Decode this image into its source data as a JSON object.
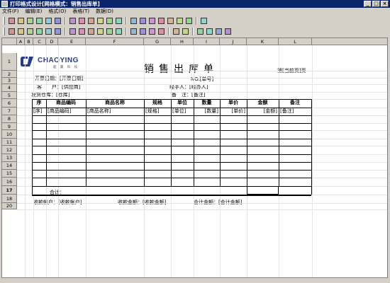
{
  "window": {
    "title": "打印格式设计[网格模式：销售出库单]"
  },
  "menu": [
    "文件(F)",
    "编辑(E)",
    "格式(O)",
    "表格(T)",
    "数据(D)"
  ],
  "toolbar1": [
    "save-icon",
    "save-as-icon",
    "open-icon",
    "preview-icon",
    "print-icon",
    "export-icon",
    "undo-icon",
    "redo-icon",
    "cut-icon",
    "copy-icon",
    "paste-icon",
    "find-icon",
    "format-painter-icon",
    "picture-icon",
    "chart-icon",
    "image-icon",
    "table-icon",
    "border-icon",
    "pen-icon",
    "exit-icon"
  ],
  "toolbar2": [
    "insert-row-icon",
    "delete-row-icon",
    "insert-col-icon",
    "delete-col-icon",
    "merge-icon",
    "split-icon",
    "align-left-icon",
    "align-center-icon",
    "align-right-icon",
    "valign-top-icon",
    "valign-middle-icon",
    "valign-bottom-icon",
    "justify-icon",
    "distribute-icon",
    "border-all-icon",
    "border-outer-icon",
    "font-bigger-icon",
    "font-smaller-icon",
    "text-color-icon",
    "cell-color-icon",
    "fill-color-icon",
    "eraser-icon"
  ],
  "columns": [
    "A",
    "B",
    "C",
    "D",
    "E",
    "F",
    "G",
    "H",
    "I",
    "J",
    "K",
    "L"
  ],
  "rows": [
    "1",
    "2",
    "3",
    "4",
    "5",
    "6",
    "7",
    "8",
    "9",
    "10",
    "11",
    "12",
    "13",
    "14",
    "15",
    "16",
    "17",
    "18",
    "20"
  ],
  "logo": {
    "name": "CHAOYING",
    "sub": "超 赢 科 技"
  },
  "doc": {
    "title": "销售出库单",
    "page_info": "第[当前页]页",
    "no_label": "NO.[单号]",
    "date_label": "开票日期：[开票日期]",
    "customer_label": "客　　户：[供应商]",
    "handler_label": "经手人：[经办人]",
    "warehouse_label": "发货仓库：[仓库]",
    "remark_label": "备　注：[备注]"
  },
  "table": {
    "headers": [
      "序",
      "商品编码",
      "商品名称",
      "规格",
      "单位",
      "数量",
      "单价",
      "金额",
      "备注"
    ],
    "fields": [
      "[序]",
      "[商品编码]",
      "[商品名称]",
      "[规格]",
      "[单位]",
      "[数量]",
      "[单价]",
      "[金额]",
      "[备注]"
    ],
    "total_label": "合计："
  },
  "footer": {
    "account": "收款帐户：[收款帐户]",
    "received": "收款金额：[收款金额]",
    "total": "合计金额：[合计金额]"
  }
}
